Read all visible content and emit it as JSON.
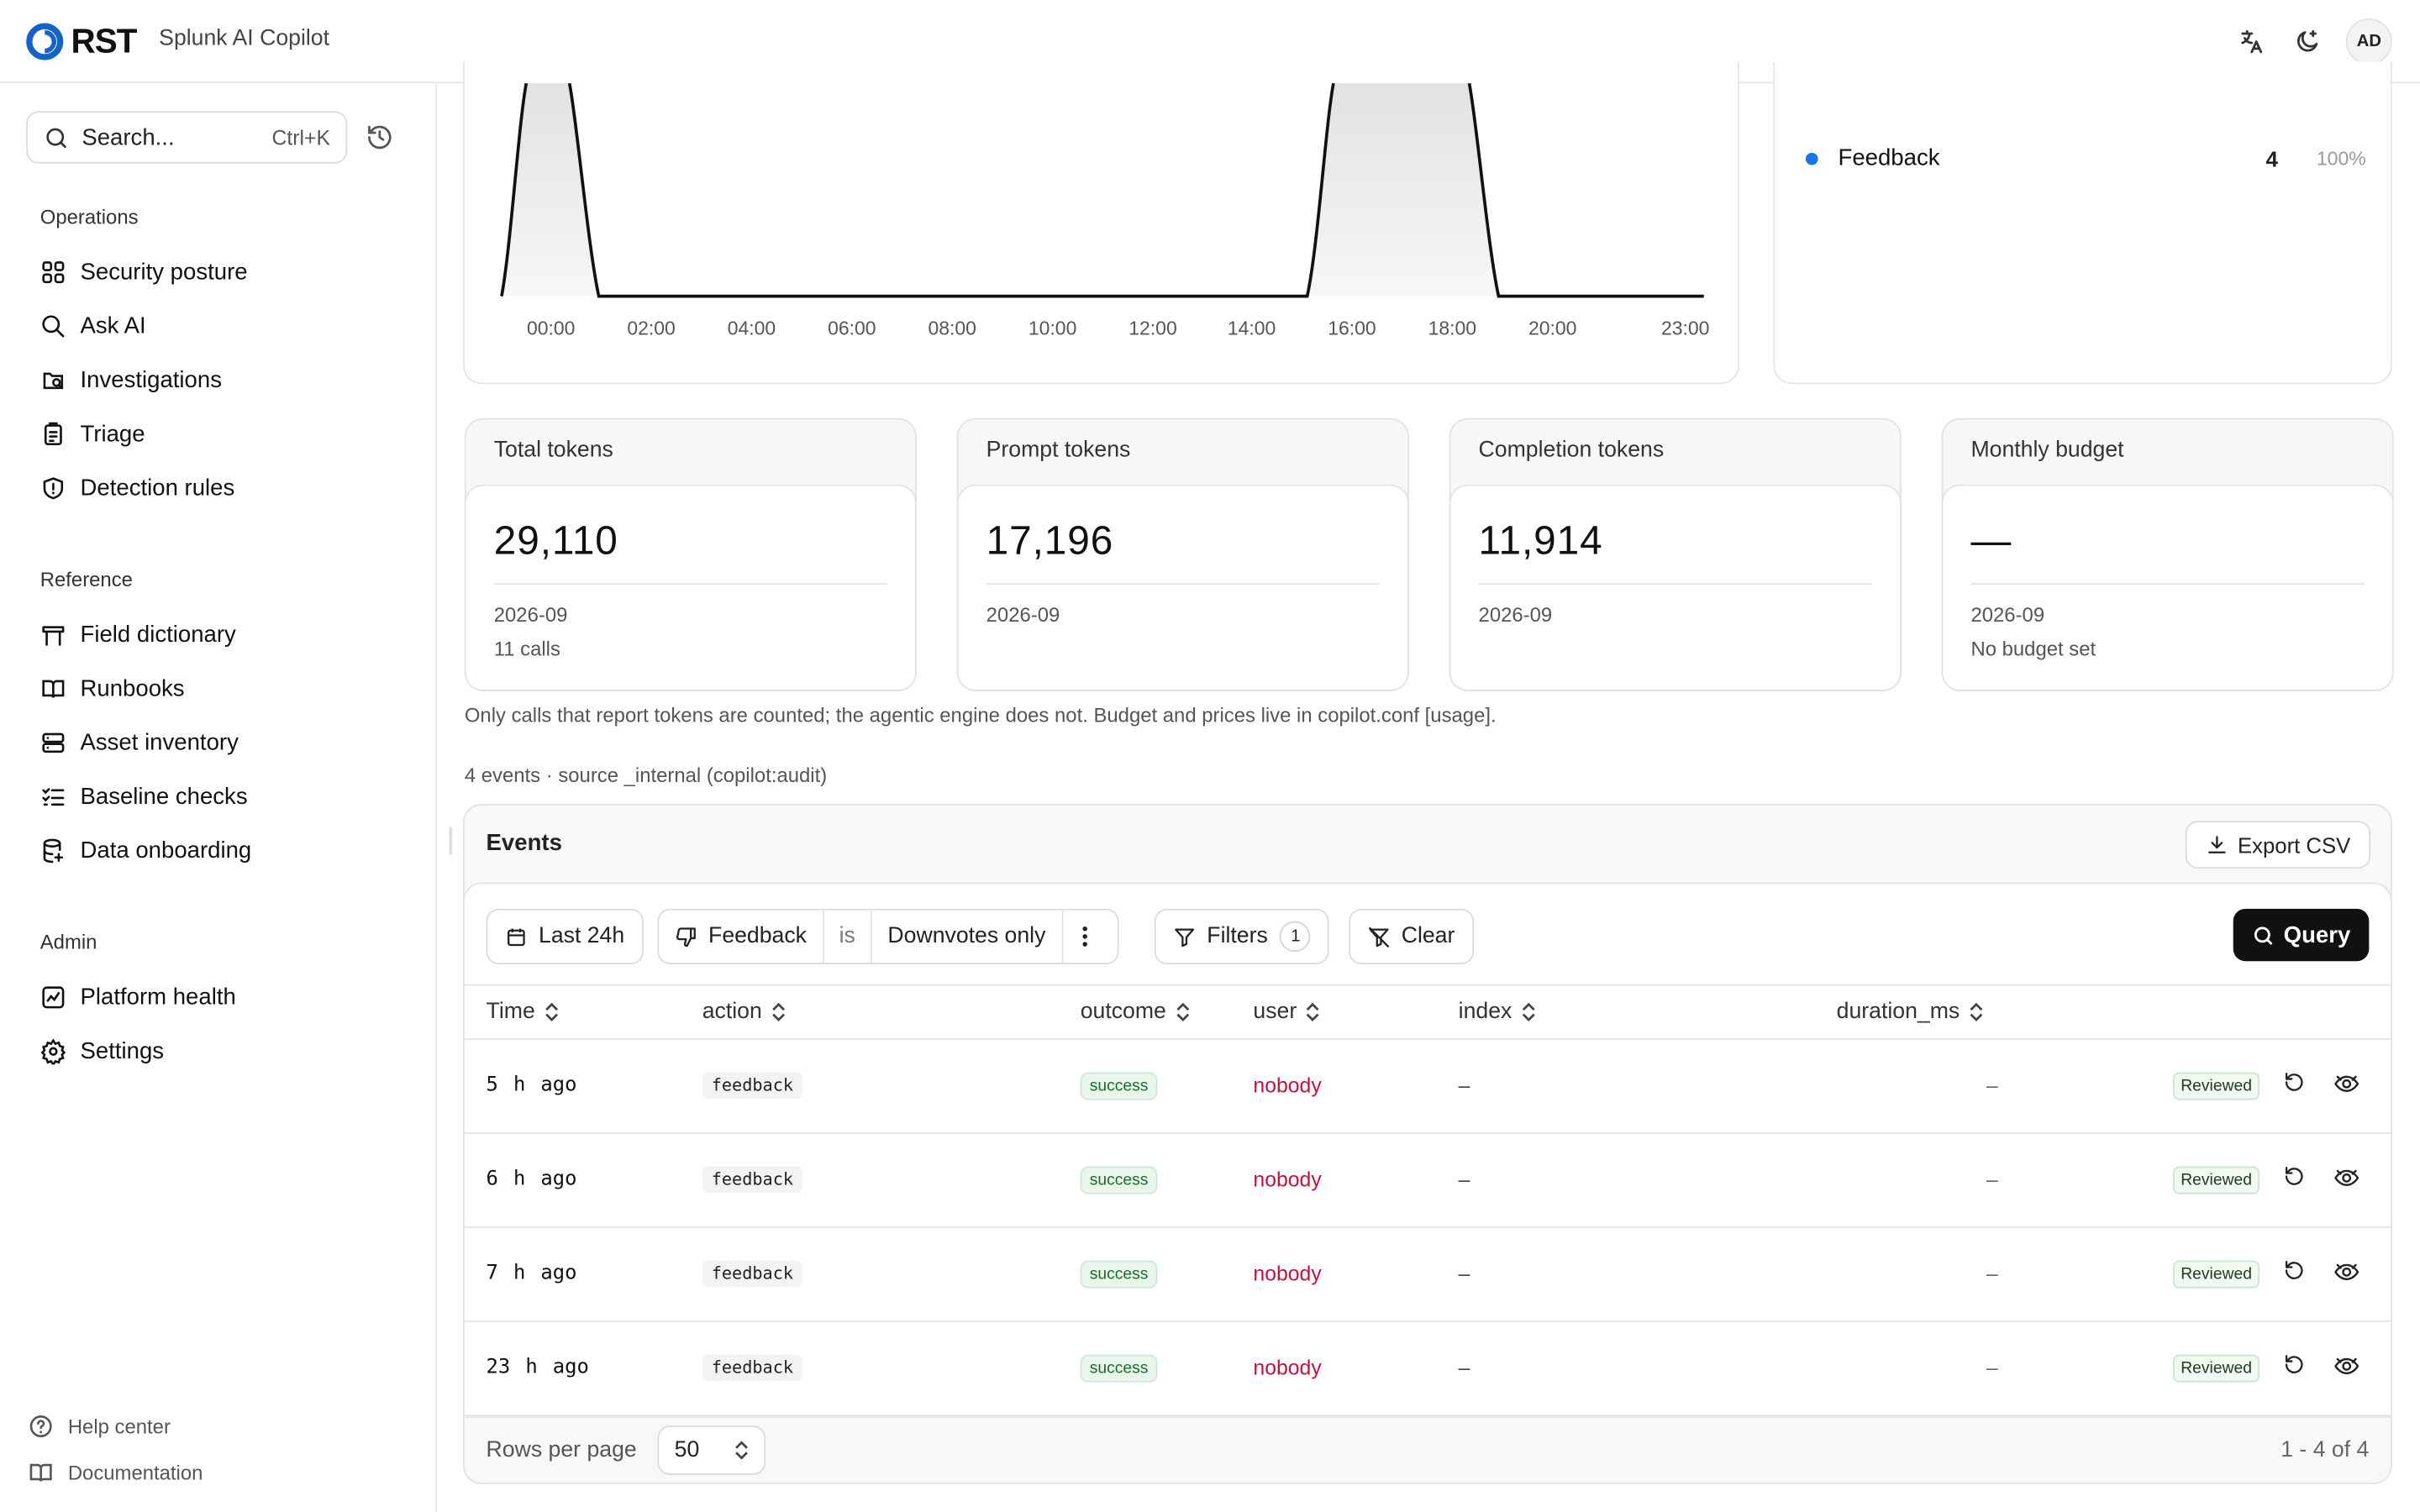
{
  "header": {
    "logo_text": "RST",
    "app_name": "Splunk AI Copilot",
    "avatar_initials": "AD",
    "icons": [
      "translate-icon",
      "theme-toggle-icon"
    ]
  },
  "sidebar": {
    "search_placeholder": "Search...",
    "search_shortcut": "Ctrl+K",
    "sections": [
      {
        "title": "Operations",
        "items": [
          {
            "label": "Security posture",
            "icon": "grid-icon"
          },
          {
            "label": "Ask AI",
            "icon": "search-icon"
          },
          {
            "label": "Investigations",
            "icon": "investigation-icon"
          },
          {
            "label": "Triage",
            "icon": "clipboard-icon"
          },
          {
            "label": "Detection rules",
            "icon": "shield-icon"
          }
        ]
      },
      {
        "title": "Reference",
        "items": [
          {
            "label": "Field dictionary",
            "icon": "table-icon"
          },
          {
            "label": "Runbooks",
            "icon": "book-icon"
          },
          {
            "label": "Asset inventory",
            "icon": "server-icon"
          },
          {
            "label": "Baseline checks",
            "icon": "checklist-icon"
          },
          {
            "label": "Data onboarding",
            "icon": "database-icon"
          }
        ]
      },
      {
        "title": "Admin",
        "items": [
          {
            "label": "Platform health",
            "icon": "chart-icon"
          },
          {
            "label": "Settings",
            "icon": "gear-icon"
          }
        ]
      }
    ],
    "footer": [
      {
        "label": "Help center",
        "icon": "help-icon"
      },
      {
        "label": "Documentation",
        "icon": "book-icon"
      }
    ]
  },
  "chart": {
    "x_ticks": [
      "00:00",
      "02:00",
      "04:00",
      "06:00",
      "08:00",
      "10:00",
      "12:00",
      "14:00",
      "16:00",
      "18:00",
      "20:00",
      "23:00"
    ]
  },
  "legend": {
    "name": "Feedback",
    "count": "4",
    "percent": "100%",
    "color": "#1a73e8"
  },
  "stats": [
    {
      "title": "Total tokens",
      "value": "29,110",
      "sub1": "2026-09",
      "sub2": "11 calls"
    },
    {
      "title": "Prompt tokens",
      "value": "17,196",
      "sub1": "2026-09",
      "sub2": ""
    },
    {
      "title": "Completion tokens",
      "value": "11,914",
      "sub1": "2026-09",
      "sub2": ""
    },
    {
      "title": "Monthly budget",
      "value": "—",
      "sub1": "2026-09",
      "sub2": "No budget set"
    }
  ],
  "note": "Only calls that report tokens are counted; the agentic engine does not. Budget and prices live in copilot.conf [usage].",
  "events_meta": "4 events · source _internal (copilot:audit)",
  "events": {
    "title": "Events",
    "export_label": "Export CSV",
    "filters": {
      "range": "Last 24h",
      "field": "Feedback",
      "operator": "is",
      "value": "Downvotes only",
      "filters_label": "Filters",
      "filters_count": "1",
      "clear_label": "Clear",
      "query_label": "Query"
    },
    "columns": [
      "Time",
      "action",
      "outcome",
      "user",
      "index",
      "duration_ms"
    ],
    "rows": [
      {
        "time": "5 h ago",
        "action": "feedback",
        "outcome": "success",
        "user": "nobody",
        "index": "–",
        "duration": "–",
        "status": "Reviewed"
      },
      {
        "time": "6 h ago",
        "action": "feedback",
        "outcome": "success",
        "user": "nobody",
        "index": "–",
        "duration": "–",
        "status": "Reviewed"
      },
      {
        "time": "7 h ago",
        "action": "feedback",
        "outcome": "success",
        "user": "nobody",
        "index": "–",
        "duration": "–",
        "status": "Reviewed"
      },
      {
        "time": "23 h ago",
        "action": "feedback",
        "outcome": "success",
        "user": "nobody",
        "index": "–",
        "duration": "–",
        "status": "Reviewed"
      }
    ],
    "rows_per_page_label": "Rows per page",
    "rows_per_page": "50",
    "page_info": "1 - 4 of 4"
  }
}
